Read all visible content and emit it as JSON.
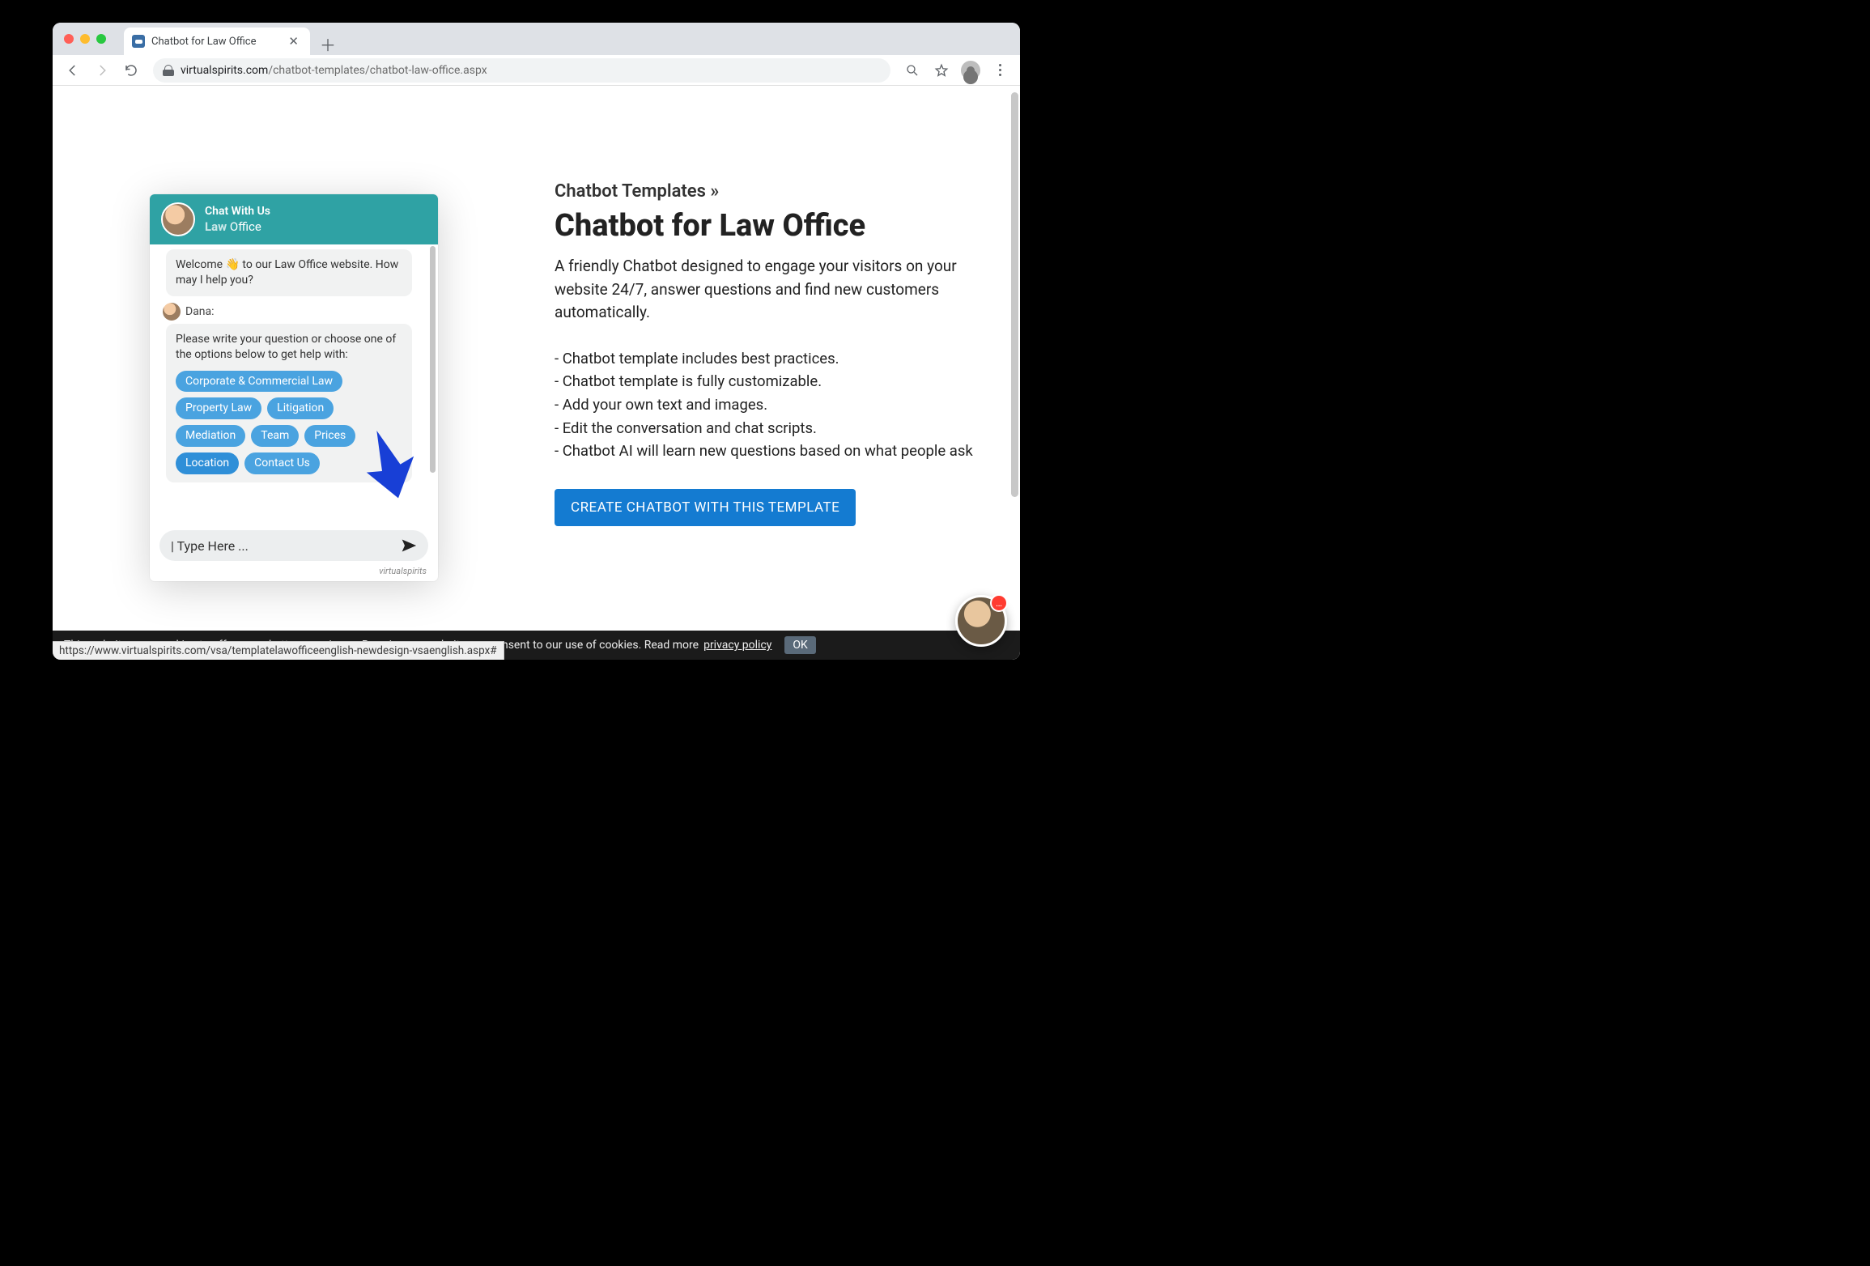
{
  "browser": {
    "tab_title": "Chatbot for Law Office",
    "url_host": "virtualspirits.com",
    "url_path": "/chatbot-templates/chatbot-law-office.aspx",
    "status_hover": "https://www.virtualspirits.com/vsa/templatelawofficeenglish-newdesign-vsaenglish.aspx#"
  },
  "chat": {
    "header_title": "Chat With Us",
    "header_company_bold": "Law",
    "header_company_rest": " Office",
    "welcome": "Welcome 👋 to our Law Office website. How may I help you?",
    "sender_name": "Dana:",
    "prompt": "Please write your question or choose one of the options below to get help with:",
    "chips": [
      "Corporate & Commercial Law",
      "Property Law",
      "Litigation",
      "Mediation",
      "Team",
      "Prices",
      "Location",
      "Contact Us"
    ],
    "highlight_chip": "Location",
    "input_placeholder": "| Type Here ...",
    "brand": "virtualspirits"
  },
  "content": {
    "breadcrumb": "Chatbot Templates »",
    "heading": "Chatbot for Law Office",
    "lead": "A friendly Chatbot designed to engage your visitors on your website 24/7, answer questions and find new customers automatically.",
    "bullets": [
      "- Chatbot template includes best practices.",
      "- Chatbot template is fully customizable.",
      "- Add your own text and images.",
      "- Edit the conversation and chat scripts.",
      "- Chatbot AI will learn new questions based on what people ask"
    ],
    "cta": "CREATE CHATBOT WITH THIS TEMPLATE"
  },
  "cookie": {
    "text": "This website uses cookies to offer you a better experience. By using our website you consent to our use of cookies. Read more ",
    "link": "privacy policy",
    "ok": "OK"
  },
  "fab": {
    "badge": "…"
  }
}
